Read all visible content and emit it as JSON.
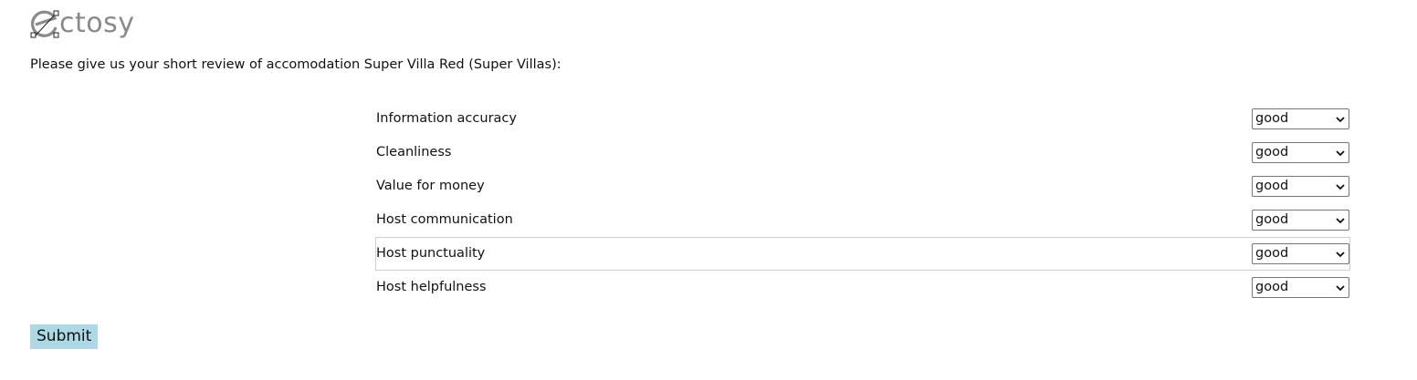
{
  "brand": {
    "logo_text": "ctosy",
    "logo_icon": "ectosy-logo-e-icon"
  },
  "intro_text": "Please give us your short review of accomodation Super Villa Red (Super Villas):",
  "ratings": [
    {
      "label": "Information accuracy",
      "value": "good"
    },
    {
      "label": "Cleanliness",
      "value": "good"
    },
    {
      "label": "Value for money",
      "value": "good"
    },
    {
      "label": "Host communication",
      "value": "good"
    },
    {
      "label": "Host punctuality",
      "value": "good"
    },
    {
      "label": "Host helpfulness",
      "value": "good"
    }
  ],
  "submit_label": "Submit",
  "colors": {
    "submit_bg": "#add8e6",
    "logo_text": "#8a8a8a"
  }
}
